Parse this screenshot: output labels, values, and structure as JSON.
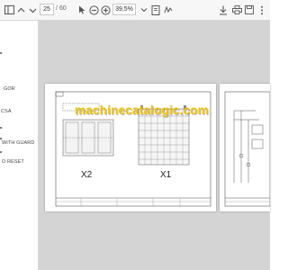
{
  "toolbar": {
    "page_current": "25",
    "page_separator": "/",
    "page_total": "60",
    "zoom": "39,5%",
    "icons": [
      "sidebar-toggle",
      "chevron-up",
      "chevron-down",
      "pointer",
      "hand",
      "zoom-out",
      "zoom-in",
      "fit-page",
      "download",
      "print",
      "save",
      "more"
    ]
  },
  "sidebar": {
    "items": [
      {
        "label": "GOR"
      },
      {
        "label": "CSA"
      },
      {
        "label": "WITH GUARD"
      },
      {
        "label": "O RESET"
      }
    ]
  },
  "document": {
    "page1": {
      "label_left": "X2",
      "label_right": "X1"
    },
    "watermark": "machinecatalogic.com"
  }
}
